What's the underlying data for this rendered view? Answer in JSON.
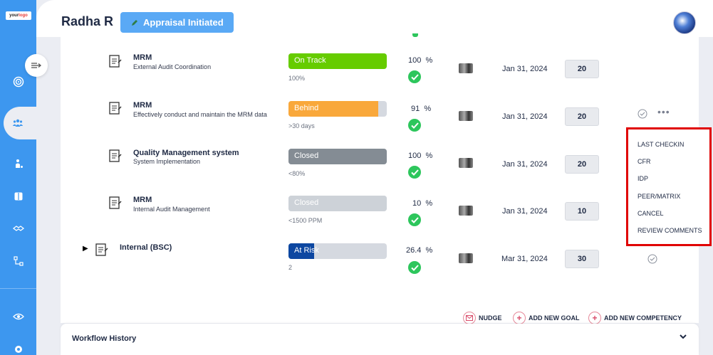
{
  "sidebar": {
    "logo_main": "your",
    "logo_accent": "logo"
  },
  "header": {
    "user_name": "Radha R",
    "status_label": "Appraisal Initiated"
  },
  "goals": [
    {
      "title": "MRM",
      "subtitle": "External Audit Coordination",
      "status": "On Track",
      "progress": 1.0,
      "bar_color": "#66cc00",
      "note": "100%",
      "pct": "100",
      "date": "Jan 31, 2024",
      "score": "20"
    },
    {
      "title": "MRM",
      "subtitle": "Effectively conduct and maintain the MRM data",
      "status": "Behind",
      "progress": 0.91,
      "bar_color": "#f9a83b",
      "note": ">30 days",
      "pct": "91",
      "date": "Jan 31, 2024",
      "score": "20"
    },
    {
      "title": "Quality Management system",
      "subtitle": "System Implementation",
      "status": "Closed",
      "progress": 1.0,
      "bar_color": "#848c94",
      "note": "<80%",
      "pct": "100",
      "date": "Jan 31, 2024",
      "score": "20"
    },
    {
      "title": "MRM",
      "subtitle": "Internal Audit Management",
      "status": "Closed",
      "progress": 1.0,
      "bar_color": "#cdd2d8",
      "note": "<1500 PPM",
      "pct": "10",
      "date": "Jan 31, 2024",
      "score": "10"
    },
    {
      "title": "Internal (BSC)",
      "subtitle": "",
      "status": "At Risk",
      "progress": 0.26,
      "bar_color": "#0d47a1",
      "note": "2",
      "pct": "26.4",
      "date": "Mar 31, 2024",
      "score": "30"
    }
  ],
  "percent_sign": "%",
  "actions": {
    "nudge": "NUDGE",
    "add_goal": "ADD NEW GOAL",
    "add_competency": "ADD NEW COMPETENCY"
  },
  "workflow": {
    "title": "Workflow History"
  },
  "context_menu": {
    "items": [
      "LAST CHECKIN",
      "CFR",
      "IDP",
      "PEER/MATRIX",
      "CANCEL",
      "REVIEW COMMENTS"
    ]
  }
}
